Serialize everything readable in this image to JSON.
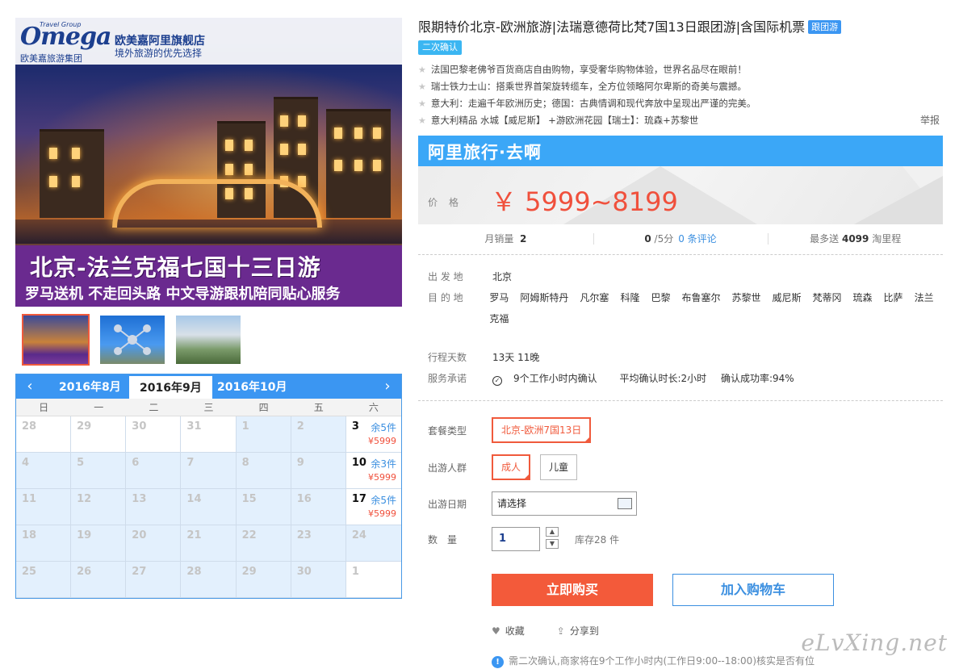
{
  "hero": {
    "logo_text": "Omega",
    "logo_sub": "Travel Group",
    "logo_cn": "欧美嘉旅游集团",
    "store_name": "欧美嘉阿里旗舰店",
    "store_slogan": "境外旅游的优先选择",
    "banner_title": "北京-法兰克福七国十三日游",
    "banner_sub": "罗马送机 不走回头路 中文导游跟机陪同贴心服务"
  },
  "calendar": {
    "prev_icon": "chevron-left-icon",
    "next_icon": "chevron-right-icon",
    "months": [
      "2016年8月",
      "2016年9月",
      "2016年10月"
    ],
    "active_month": "2016年9月",
    "weekdays": [
      "日",
      "一",
      "二",
      "三",
      "四",
      "五",
      "六"
    ],
    "cells": [
      {
        "d": "28"
      },
      {
        "d": "29"
      },
      {
        "d": "30"
      },
      {
        "d": "31"
      },
      {
        "d": "1",
        "cur": true
      },
      {
        "d": "2",
        "cur": true
      },
      {
        "d": "3",
        "avail": true,
        "left": "余5件",
        "price": "¥5999"
      },
      {
        "d": "4",
        "cur": true
      },
      {
        "d": "5",
        "cur": true
      },
      {
        "d": "6",
        "cur": true
      },
      {
        "d": "7",
        "cur": true
      },
      {
        "d": "8",
        "cur": true
      },
      {
        "d": "9",
        "cur": true
      },
      {
        "d": "10",
        "avail": true,
        "left": "余3件",
        "price": "¥5999"
      },
      {
        "d": "11",
        "cur": true
      },
      {
        "d": "12",
        "cur": true
      },
      {
        "d": "13",
        "cur": true
      },
      {
        "d": "14",
        "cur": true
      },
      {
        "d": "15",
        "cur": true
      },
      {
        "d": "16",
        "cur": true
      },
      {
        "d": "17",
        "avail": true,
        "left": "余5件",
        "price": "¥5999"
      },
      {
        "d": "18",
        "cur": true
      },
      {
        "d": "19",
        "cur": true
      },
      {
        "d": "20",
        "cur": true
      },
      {
        "d": "21",
        "cur": true
      },
      {
        "d": "22",
        "cur": true
      },
      {
        "d": "23",
        "cur": true
      },
      {
        "d": "24",
        "cur": true
      },
      {
        "d": "25",
        "cur": true
      },
      {
        "d": "26",
        "cur": true
      },
      {
        "d": "27",
        "cur": true
      },
      {
        "d": "28",
        "cur": true
      },
      {
        "d": "29",
        "cur": true
      },
      {
        "d": "30",
        "cur": true
      },
      {
        "d": "1"
      }
    ]
  },
  "product": {
    "title": "限期特价北京-欧洲旅游|法瑞意德荷比梵7国13日跟团游|含国际机票",
    "tag": "跟团游",
    "tag2": "二次确认",
    "features": [
      "法国巴黎老佛爷百货商店自由购物，享受奢华购物体验，世界名品尽在眼前！",
      "瑞士铁力士山：搭乘世界首架旋转缆车，全方位领略阿尔卑斯的奇美与震撼。",
      "意大利：走遍千年欧洲历史；德国：古典情调和现代奔放中呈现出严谨的完美。",
      "意大利精品 水城【威尼斯】 +游欧洲花园【瑞士】：琉森+苏黎世"
    ],
    "report": "举报"
  },
  "pricebox": {
    "brand": "阿里旅行·去啊",
    "label": "价格",
    "value": "￥ 5999~8199"
  },
  "stats": {
    "sales_label": "月销量",
    "sales_value": "2",
    "rating_value": "0",
    "rating_suffix": "/5分",
    "reviews_link": "0 条评论",
    "points_prefix": "最多送",
    "points_value": "4099",
    "points_suffix": "淘里程"
  },
  "info": {
    "from_label": "出 发 地",
    "from_value": "北京",
    "to_label": "目 的 地",
    "destinations": [
      "罗马",
      "阿姆斯特丹",
      "凡尔塞",
      "科隆",
      "巴黎",
      "布鲁塞尔",
      "苏黎世",
      "威尼斯",
      "梵蒂冈",
      "琉森",
      "比萨",
      "法兰克福"
    ],
    "days_label": "行程天数",
    "days_value": "13天 11晚",
    "svc_label": "服务承诺",
    "svc_icon": "check-circle-icon",
    "svc_items": [
      "9个工作小时内确认",
      "平均确认时长:2小时",
      "确认成功率:94%"
    ]
  },
  "options": {
    "package_label": "套餐类型",
    "package_value": "北京-欧洲7国13日",
    "crowd_label": "出游人群",
    "crowd_adult": "成人",
    "crowd_child": "儿童",
    "date_label": "出游日期",
    "date_placeholder": "请选择",
    "qty_label": "数　量",
    "qty_value": "1",
    "stock": "库存28 件"
  },
  "actions": {
    "buy": "立即购买",
    "cart": "加入购物车",
    "fav_icon": "heart-icon",
    "fav": "收藏",
    "share_icon": "share-icon",
    "share": "分享到"
  },
  "note": {
    "icon": "info-icon",
    "text": "需二次确认,商家将在9个工作小时内(工作日9:00--18:00)核实是否有位"
  },
  "watermark": "eLvXing.net",
  "colors": {
    "accent_blue": "#3b96f2",
    "price_red": "#f0503c",
    "buy_red": "#f35a3a"
  }
}
